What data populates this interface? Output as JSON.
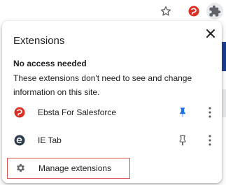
{
  "toolbar": {
    "icons": [
      "star-icon",
      "ebsta-extension-icon",
      "extensions-puzzle-icon"
    ]
  },
  "popup": {
    "title": "Extensions",
    "section_heading": "No access needed",
    "section_desc": "These extensions don't need to see and change information on this site.",
    "extensions": [
      {
        "name": "Ebsta For Salesforce",
        "pinned": true,
        "icon": "ebsta-icon"
      },
      {
        "name": "IE Tab",
        "pinned": false,
        "icon": "ie-tab-icon"
      }
    ],
    "manage_label": "Manage extensions"
  },
  "colors": {
    "pin_active": "#1a73e8",
    "pin_inactive": "#5f6368",
    "ebsta_red": "#d93025",
    "ie_tab_navy": "#2d3a4a",
    "highlight_border": "#d9534f"
  }
}
